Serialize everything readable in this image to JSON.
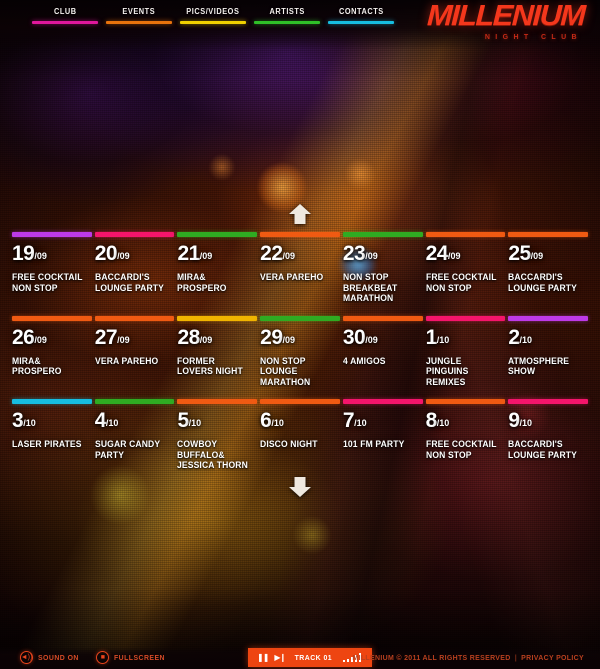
{
  "site": {
    "logo_main": "MILLENIUM",
    "logo_sub": "NIGHT CLUB",
    "logo_color": "#f4371c"
  },
  "nav": {
    "items": [
      {
        "label": "CLUB",
        "rule_color": "#e0179c"
      },
      {
        "label": "EVENTS",
        "rule_color": "#e8730c"
      },
      {
        "label": "PICS/VIDEOS",
        "rule_color": "#f0d000"
      },
      {
        "label": "ARTISTS",
        "rule_color": "#2fbf28"
      },
      {
        "label": "CONTACTS",
        "rule_color": "#17bde0"
      }
    ]
  },
  "scroll": {
    "up_label": "scroll-up",
    "down_label": "scroll-down"
  },
  "calendar": {
    "rows": [
      {
        "bars": [
          "#bd3ae8",
          "#f4156b",
          "#2fab22",
          "#f05a12",
          "#2fab22",
          "#f05a12",
          "#f05a12"
        ],
        "cells": [
          {
            "day": "19",
            "month": "/09",
            "title": "FREE COCKTAIL NON STOP",
            "highlight": false
          },
          {
            "day": "20",
            "month": "/09",
            "title": "BACCARDI'S LOUNGE PARTY",
            "highlight": false
          },
          {
            "day": "21",
            "month": "/09",
            "title": "MIRA& PROSPERO",
            "highlight": false
          },
          {
            "day": "22",
            "month": "/09",
            "title": "VERA PAREHO",
            "highlight": false
          },
          {
            "day": "23",
            "month": "/09",
            "title": "NON STOP BREAKBEAT MARATHON",
            "highlight": true
          },
          {
            "day": "24",
            "month": "/09",
            "title": "FREE COCKTAIL NON STOP",
            "highlight": false
          },
          {
            "day": "25",
            "month": "/09",
            "title": "BACCARDI'S LOUNGE PARTY",
            "highlight": false
          }
        ]
      },
      {
        "bars": [
          "#f05a12",
          "#f05a12",
          "#f0b400",
          "#2fab22",
          "#f05a12",
          "#f4156b",
          "#bd3ae8"
        ],
        "cells": [
          {
            "day": "26",
            "month": "/09",
            "title": "MIRA& PROSPERO",
            "highlight": false
          },
          {
            "day": "27",
            "month": "/09",
            "title": "VERA PAREHO",
            "highlight": false
          },
          {
            "day": "28",
            "month": "/09",
            "title": "FORMER LOVERS NIGHT",
            "highlight": false
          },
          {
            "day": "29",
            "month": "/09",
            "title": "NON STOP LOUNGE MARATHON",
            "highlight": false
          },
          {
            "day": "30",
            "month": "/09",
            "title": "4 AMIGOS",
            "highlight": false
          },
          {
            "day": "1",
            "month": "/10",
            "title": "JUNGLE PINGUINS REMIXES",
            "highlight": false
          },
          {
            "day": "2",
            "month": "/10",
            "title": "ATMOSPHERE SHOW",
            "highlight": false
          }
        ]
      },
      {
        "bars": [
          "#17bde0",
          "#2fab22",
          "#f05a12",
          "#f05a12",
          "#f4156b",
          "#f05a12",
          "#f4156b"
        ],
        "cells": [
          {
            "day": "3",
            "month": "/10",
            "title": "LASER PIRATES",
            "highlight": false
          },
          {
            "day": "4",
            "month": "/10",
            "title": "SUGAR CANDY PARTY",
            "highlight": false
          },
          {
            "day": "5",
            "month": "/10",
            "title": "COWBOY BUFFALO& JESSICA THORN",
            "highlight": false
          },
          {
            "day": "6",
            "month": "/10",
            "title": "DISCO NIGHT",
            "highlight": false
          },
          {
            "day": "7",
            "month": "/10",
            "title": "101 FM PARTY",
            "highlight": false
          },
          {
            "day": "8",
            "month": "/10",
            "title": "FREE COCKTAIL NON STOP",
            "highlight": false
          },
          {
            "day": "9",
            "month": "/10",
            "title": "BACCARDI'S LOUNGE PARTY",
            "highlight": false
          }
        ]
      }
    ]
  },
  "footer": {
    "sound_label": "SOUND ON",
    "fullscreen_label": "FULLSCREEN",
    "player": {
      "pause_icon": "❚❚",
      "next_icon": "▶❙",
      "track_label": "TRACK 01",
      "accent": "#ee4511",
      "equalizer": [
        2,
        3,
        5,
        7,
        9
      ]
    },
    "copyright": "MILLENIUM © 2011 ALL RIGHTS RESERVED",
    "separator": "|",
    "privacy": "PRIVACY POLICY"
  }
}
